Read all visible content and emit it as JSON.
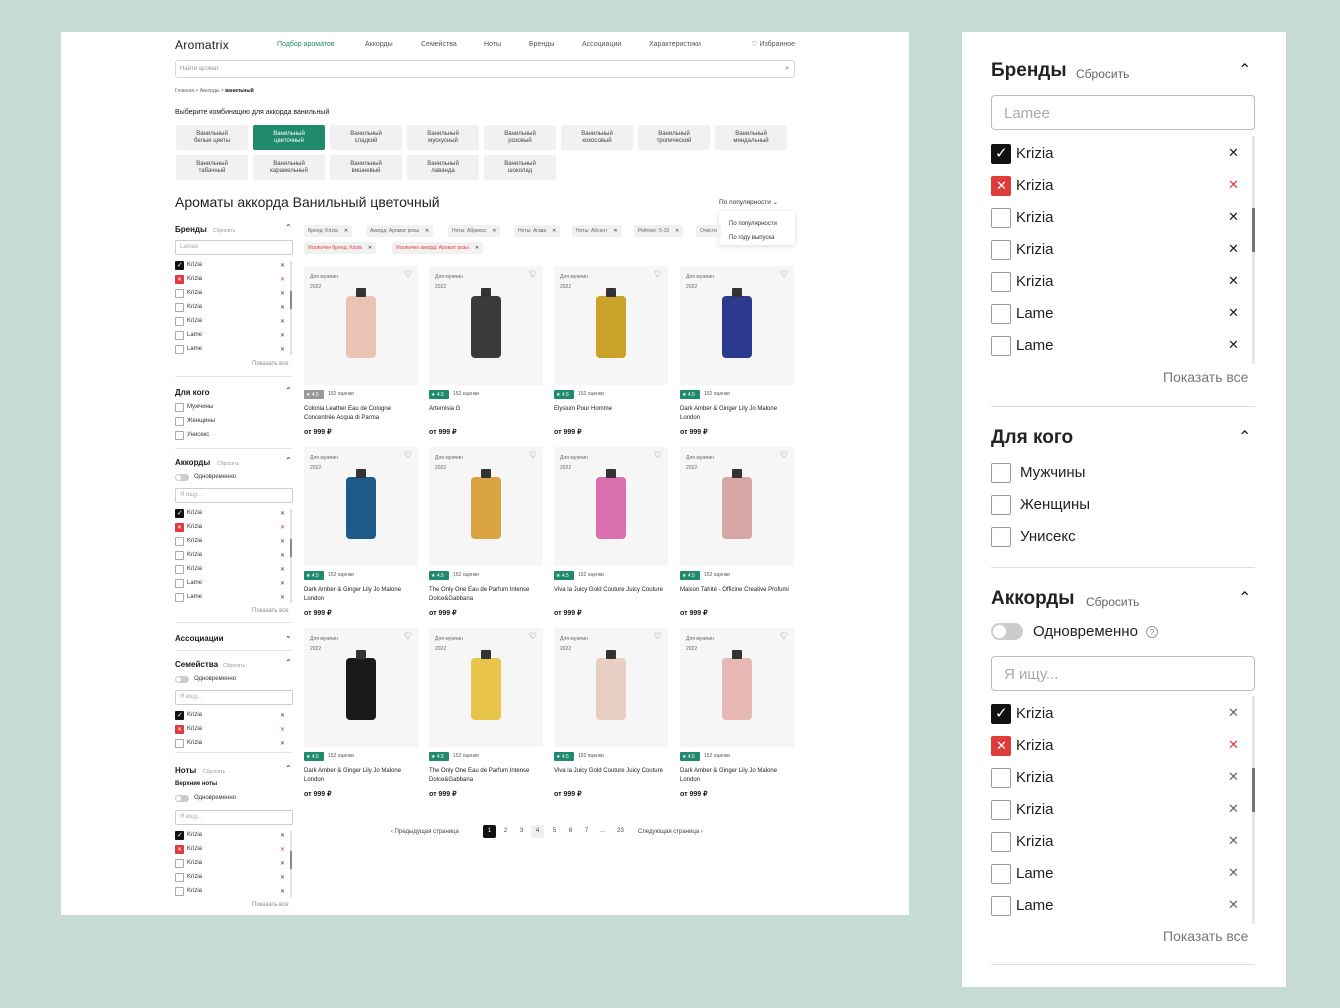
{
  "header": {
    "logo": "Aromatrix",
    "nav": [
      "Подбор ароматов",
      "Аккорды",
      "Семейства",
      "Ноты",
      "Бренды",
      "Ассоциации",
      "Характеристики"
    ],
    "favorites": "Избранное",
    "search_placeholder": "Найти аромат"
  },
  "breadcrumbs": {
    "home": "Главная",
    "section": "Аккорды",
    "current": "ванильный"
  },
  "combo": {
    "title": "Выберите комбинацию для аккорда ванильный",
    "chips": [
      {
        "l1": "Ванильный",
        "l2": "белые цветы"
      },
      {
        "l1": "Ванильный",
        "l2": "цветочный"
      },
      {
        "l1": "Ванильный",
        "l2": "сладкий"
      },
      {
        "l1": "Ванильный",
        "l2": "мускусный"
      },
      {
        "l1": "Ванильный",
        "l2": "розовый"
      },
      {
        "l1": "Ванильный",
        "l2": "кокосовый"
      },
      {
        "l1": "Ванильный",
        "l2": "тропический"
      },
      {
        "l1": "Ванильный",
        "l2": "миндальный"
      },
      {
        "l1": "Ванильный",
        "l2": "табачный"
      },
      {
        "l1": "Ванильный",
        "l2": "карамельный"
      },
      {
        "l1": "Ванильный",
        "l2": "вишневый"
      },
      {
        "l1": "Ванильный",
        "l2": "лаванда"
      },
      {
        "l1": "Ванильный",
        "l2": "шоколад"
      }
    ]
  },
  "main": {
    "title": "Ароматы аккорда Ванильный цветочный",
    "sort": {
      "selected": "По популярности",
      "options": [
        "По популярности",
        "По году выпуска"
      ]
    },
    "filters": [
      "Бренд: Krizia",
      "Аккорд: Аромат розы",
      "Ноты: Абрикос",
      "Ноты: Агава",
      "Ноты: Абсент",
      "Рейтинг: 5-10",
      "Очисти"
    ],
    "excluded": [
      "Исключен бренд: Krizia",
      "Исключен аккорд: Аромат розы"
    ]
  },
  "sidebar": {
    "brands": {
      "title": "Бренды",
      "reset": "Сбросить",
      "placeholder": "Lamee",
      "items": [
        "Krizia",
        "Krizia",
        "Krizia",
        "Krizia",
        "Krizia",
        "Lame",
        "Lame"
      ],
      "show_all": "Показать все"
    },
    "for_whom": {
      "title": "Для кого",
      "items": [
        "Мужчины",
        "Женщины",
        "Унисекс"
      ]
    },
    "accords": {
      "title": "Аккорды",
      "reset": "Сбросить",
      "toggle": "Одновременно",
      "placeholder": "Я ищу...",
      "items": [
        "Krizia",
        "Krizia",
        "Krizia",
        "Krizia",
        "Krizia",
        "Lame",
        "Lame"
      ],
      "show_all": "Показать все"
    },
    "associations": {
      "title": "Ассоциации"
    },
    "families": {
      "title": "Семейства",
      "reset": "Сбросить",
      "toggle": "Одновременно",
      "placeholder": "Я ищу...",
      "items": [
        "Krizia",
        "Krizia",
        "Krizia"
      ]
    },
    "notes": {
      "title": "Ноты",
      "reset": "Сбросить",
      "subtitle": "Верхние ноты",
      "toggle": "Одновременно",
      "placeholder": "Я ищу...",
      "items": [
        "Krizia",
        "Krizia",
        "Krizia",
        "Krizia",
        "Krizia"
      ],
      "show_all": "Показать все"
    }
  },
  "products": [
    {
      "gender": "Для мужчин",
      "year": "2022",
      "rating": "★ 4.5",
      "count": "152 оценки",
      "name": "Colonia Leather Eau de Cologne Concentrée Acqua di Parma",
      "price": "от 999 ₽",
      "color": "#e9c4b5"
    },
    {
      "gender": "Для мужчин",
      "year": "2022",
      "rating": "★ 4.5",
      "count": "152 оценки",
      "name": "Artemisia G",
      "price": "от 999 ₽",
      "color": "#3a3a3a"
    },
    {
      "gender": "Для мужчин",
      "year": "2022",
      "rating": "★ 4.5",
      "count": "152 оценки",
      "name": "Elysium Pour Homme",
      "price": "от 999 ₽",
      "color": "#c9a227"
    },
    {
      "gender": "Для мужчин",
      "year": "2022",
      "rating": "★ 4.5",
      "count": "152 оценки",
      "name": "Dark Amber & Ginger Lily Jo Malone London",
      "price": "от 999 ₽",
      "color": "#2b3a8f"
    },
    {
      "gender": "Для мужчин",
      "year": "2022",
      "rating": "★ 4.5",
      "count": "152 оценки",
      "name": "Dark Amber & Ginger Lily Jo Malone London",
      "price": "от 999 ₽",
      "color": "#1d5a8a"
    },
    {
      "gender": "Для мужчин",
      "year": "2022",
      "rating": "★ 4.5",
      "count": "152 оценки",
      "name": "The Only One Eau de Parfum Intense Dolce&Gabbana",
      "price": "от 999 ₽",
      "color": "#d9a441"
    },
    {
      "gender": "Для мужчин",
      "year": "2022",
      "rating": "★ 4.5",
      "count": "152 оценки",
      "name": "Viva la Juicy Gold Couture Juicy Couture",
      "price": "от 999 ₽",
      "color": "#d96fae"
    },
    {
      "gender": "Для мужчин",
      "year": "2022",
      "rating": "★ 4.5",
      "count": "152 оценки",
      "name": "Maison Tahité - Officine Creative Profumi",
      "price": "от 999 ₽",
      "color": "#d7a6a6"
    },
    {
      "gender": "Для мужчин",
      "year": "2022",
      "rating": "★ 4.5",
      "count": "152 оценки",
      "name": "Dark Amber & Ginger Lily Jo Malone London",
      "price": "от 999 ₽",
      "color": "#1a1a1a"
    },
    {
      "gender": "Для мужчин",
      "year": "2022",
      "rating": "★ 4.5",
      "count": "152 оценки",
      "name": "The Only One Eau de Parfum Intense Dolce&Gabbana",
      "price": "от 999 ₽",
      "color": "#e8c44a"
    },
    {
      "gender": "Для мужчин",
      "year": "2022",
      "rating": "★ 4.5",
      "count": "152 оценки",
      "name": "Viva la Juicy Gold Couture Juicy Couture",
      "price": "от 999 ₽",
      "color": "#e8cfc4"
    },
    {
      "gender": "Для мужчин",
      "year": "2022",
      "rating": "★ 4.5",
      "count": "152 оценки",
      "name": "Dark Amber & Ginger Lily Jo Malone London",
      "price": "от 999 ₽",
      "color": "#e8b8b4"
    }
  ],
  "pagination": {
    "prev": "Предыдущая страница",
    "next": "Следующая страница",
    "pages": [
      "1",
      "2",
      "3",
      "4",
      "5",
      "6",
      "7",
      "...",
      "23"
    ],
    "current": "1"
  },
  "zoom": {
    "brands": {
      "title": "Бренды",
      "reset": "Сбросить",
      "placeholder": "Lamee",
      "items": [
        "Krizia",
        "Krizia",
        "Krizia",
        "Krizia",
        "Krizia",
        "Lame",
        "Lame"
      ],
      "show_all": "Показать все"
    },
    "for_whom": {
      "title": "Для кого",
      "items": [
        "Мужчины",
        "Женщины",
        "Унисекс"
      ]
    },
    "accords": {
      "title": "Аккорды",
      "reset": "Сбросить",
      "toggle": "Одновременно",
      "placeholder": "Я ищу...",
      "items": [
        "Krizia",
        "Krizia",
        "Krizia",
        "Krizia",
        "Krizia",
        "Lame",
        "Lame"
      ],
      "show_all": "Показать все"
    }
  },
  "colors": {
    "accent": "#1f8b6c",
    "exclude": "#e03b3b",
    "background": "#c8dcd6"
  }
}
